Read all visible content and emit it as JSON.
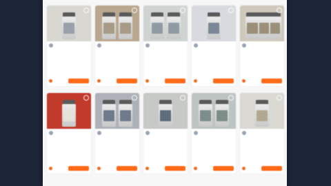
{
  "colors": {
    "accent": "#ff6a18",
    "backdrop": "#1c2438",
    "panel": "#f7f7f8"
  },
  "listing": {
    "cards": [
      {
        "thumb_bg": "#d8d7d2",
        "jar_label": "#9aa0aa",
        "jars": [
          22
        ],
        "seller": "",
        "price": "",
        "title": "",
        "subtitle": "",
        "desc": "",
        "stat": "",
        "cta": "",
        "fav_icon": "heart-icon",
        "icon": "product-jar-icon"
      },
      {
        "thumb_bg": "#b9a78f",
        "jar_label": "#a79a86",
        "jars": [
          10,
          34
        ],
        "seller": "",
        "price": "",
        "title": "",
        "subtitle": "",
        "desc": "",
        "stat": "",
        "cta": "",
        "fav_icon": "heart-icon",
        "icon": "product-jar-icon"
      },
      {
        "thumb_bg": "#cfd4d2",
        "jar_label": "#8f9aa3",
        "jars": [
          10,
          34
        ],
        "seller": "",
        "price": "",
        "title": "",
        "subtitle": "",
        "desc": "",
        "stat": "",
        "cta": "",
        "fav_icon": "heart-icon",
        "icon": "product-jar-icon"
      },
      {
        "thumb_bg": "#d9dadf",
        "jar_label": "#7b8797",
        "jars": [
          22
        ],
        "seller": "",
        "price": "",
        "title": "",
        "subtitle": "",
        "desc": "",
        "stat": "",
        "cta": "",
        "fav_icon": "heart-icon",
        "icon": "product-jar-icon"
      },
      {
        "thumb_bg": "#cfc9bb",
        "jar_label": "#9a8f79",
        "jars": [
          8,
          24,
          40
        ],
        "seller": "",
        "price": "",
        "title": "",
        "subtitle": "",
        "desc": "",
        "stat": "",
        "cta": "",
        "fav_icon": "heart-icon",
        "icon": "product-jar-icon"
      },
      {
        "thumb_bg": "#c23a2c",
        "jar_label": "#e7e2d8",
        "jars": [
          22
        ],
        "seller": "",
        "price": "",
        "title": "",
        "subtitle": "",
        "desc": "",
        "stat": "",
        "cta": "",
        "fav_icon": "heart-icon",
        "icon": "product-jar-icon"
      },
      {
        "thumb_bg": "#aeb2b8",
        "jar_label": "#6f7b8a",
        "jars": [
          10,
          34
        ],
        "seller": "",
        "price": "",
        "title": "",
        "subtitle": "",
        "desc": "",
        "stat": "",
        "cta": "",
        "fav_icon": "heart-icon",
        "icon": "product-jar-icon"
      },
      {
        "thumb_bg": "#c7c9c6",
        "jar_label": "#5e6c7e",
        "jars": [
          22
        ],
        "seller": "",
        "price": "",
        "title": "",
        "subtitle": "",
        "desc": "",
        "stat": "",
        "cta": "",
        "fav_icon": "heart-icon",
        "icon": "product-jar-icon"
      },
      {
        "thumb_bg": "#bec4c2",
        "jar_label": "#7c8d8a",
        "jars": [
          10,
          34
        ],
        "seller": "",
        "price": "",
        "title": "",
        "subtitle": "",
        "desc": "",
        "stat": "",
        "cta": "",
        "fav_icon": "heart-icon",
        "icon": "product-jar-icon"
      },
      {
        "thumb_bg": "#d9d8d2",
        "jar_label": "#b0a890",
        "jars": [
          22
        ],
        "seller": "",
        "price": "",
        "title": "",
        "subtitle": "",
        "desc": "",
        "stat": "",
        "cta": "",
        "fav_icon": "heart-icon",
        "icon": "product-jar-icon"
      }
    ]
  }
}
